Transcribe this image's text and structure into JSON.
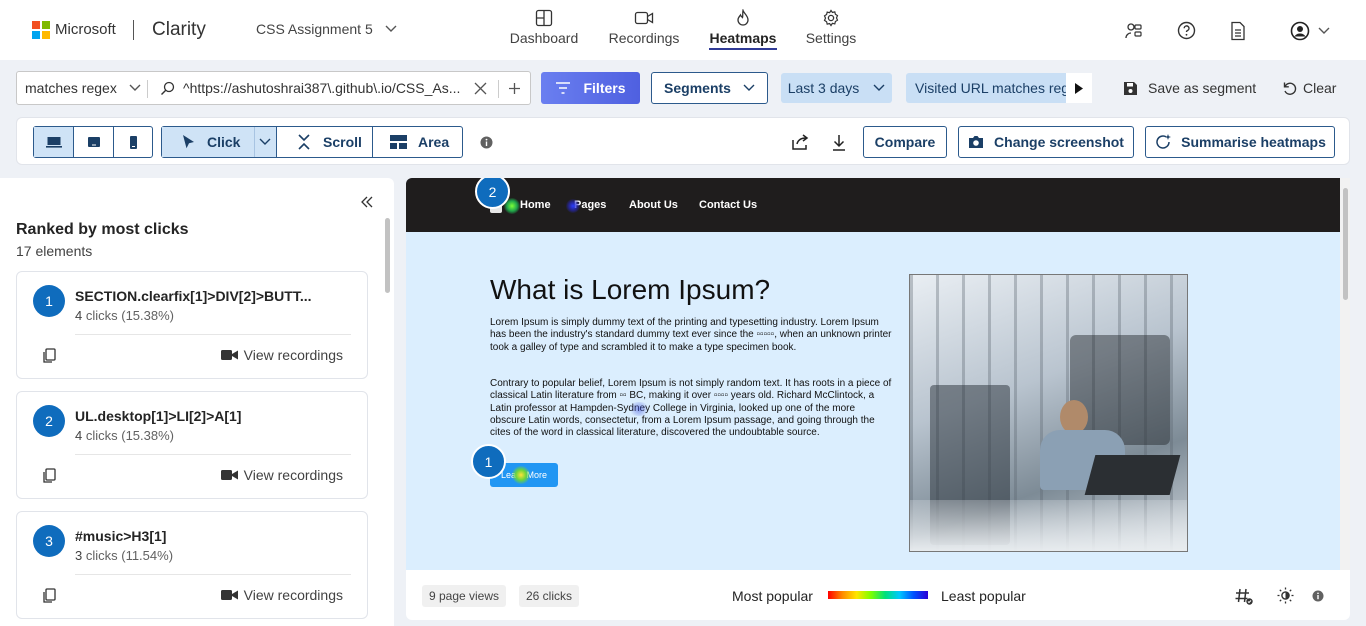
{
  "header": {
    "brand": "Microsoft",
    "app": "Clarity",
    "project": "CSS Assignment 5",
    "nav": [
      {
        "label": "Dashboard",
        "icon": "dashboard-icon"
      },
      {
        "label": "Recordings",
        "icon": "video-camera-icon"
      },
      {
        "label": "Heatmaps",
        "icon": "flame-icon",
        "active": true
      },
      {
        "label": "Settings",
        "icon": "gear-icon"
      }
    ]
  },
  "filterbar": {
    "match_type": "matches regex",
    "url_value": "^https://ashutoshrai387\\.github\\.io/CSS_As...",
    "filters_label": "Filters",
    "segments_label": "Segments",
    "date_label": "Last 3 days",
    "chip_label": "Visited URL matches rege",
    "save_label": "Save as segment",
    "clear_label": "Clear"
  },
  "toolbar": {
    "click_label": "Click",
    "scroll_label": "Scroll",
    "area_label": "Area",
    "compare_label": "Compare",
    "change_label": "Change screenshot",
    "summarise_label": "Summarise heatmaps"
  },
  "panel": {
    "title": "Ranked by most clicks",
    "count": "17 elements",
    "view_label": "View recordings",
    "items": [
      {
        "rank": "1",
        "selector": "SECTION.clearfix[1]>DIV[2]>BUTT...",
        "clicks": "4",
        "unit": " clicks ",
        "pct": "(15.38%)"
      },
      {
        "rank": "2",
        "selector": "UL.desktop[1]>LI[2]>A[1]",
        "clicks": "4",
        "unit": " clicks ",
        "pct": "(15.38%)"
      },
      {
        "rank": "3",
        "selector": "#music>H3[1]",
        "clicks": "3",
        "unit": " clicks ",
        "pct": "(11.54%)"
      }
    ]
  },
  "site": {
    "nav": [
      "Home",
      "Pages",
      "About Us",
      "Contact Us"
    ],
    "heading": "What is Lorem Ipsum?",
    "para1": "Lorem Ipsum is simply dummy text of the printing and typesetting industry. Lorem Ipsum has been the industry's standard dummy text ever since the ▫▫▫▫▫, when an unknown printer took a galley of type and scrambled it to make a type specimen book.",
    "para2": "Contrary to popular belief, Lorem Ipsum is not simply random text. It has roots in a piece of classical Latin literature from ▫▫ BC, making it over ▫▫▫▫ years old. Richard McClintock, a Latin professor at Hampden-Sydney College in Virginia, looked up one of the more obscure Latin words, consectetur, from a Lorem Ipsum passage, and going through the cites of the word in classical literature, discovered the undoubtable source.",
    "button": "Learn More",
    "marker1": "1",
    "marker2": "2"
  },
  "footer": {
    "page_views": "9 page views",
    "clicks": "26 clicks",
    "most": "Most popular",
    "least": "Least popular"
  },
  "colors": {
    "accent": "#0f6cbd",
    "filters": "#5b6de8",
    "site_nav": "#1f1d1d",
    "site_bg": "#dbeefe",
    "site_btn": "#2196f3"
  }
}
